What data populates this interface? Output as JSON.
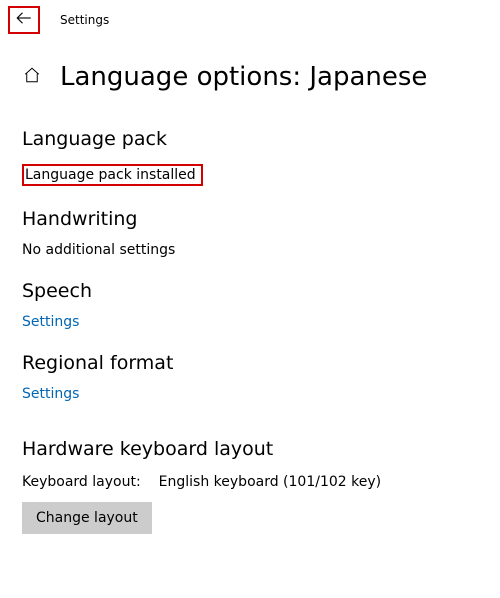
{
  "topbar": {
    "title": "Settings"
  },
  "header": {
    "title": "Language options: Japanese"
  },
  "sections": {
    "language_pack": {
      "heading": "Language pack",
      "status": "Language pack installed"
    },
    "handwriting": {
      "heading": "Handwriting",
      "text": "No additional settings"
    },
    "speech": {
      "heading": "Speech",
      "link": "Settings"
    },
    "regional": {
      "heading": "Regional format",
      "link": "Settings"
    },
    "hardware": {
      "heading": "Hardware keyboard layout",
      "label": "Keyboard layout:",
      "value": "English keyboard (101/102 key)",
      "button": "Change layout"
    }
  }
}
